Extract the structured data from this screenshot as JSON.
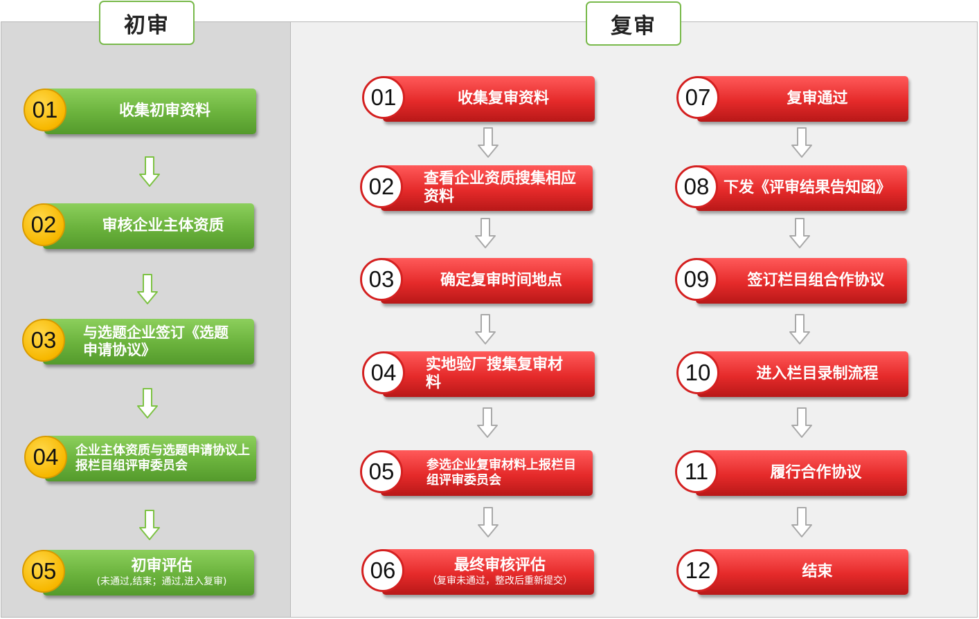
{
  "preliminary": {
    "title": "初审",
    "steps": [
      {
        "num": "01",
        "text": "收集初审资料",
        "sub": ""
      },
      {
        "num": "02",
        "text": "审核企业主体资质",
        "sub": ""
      },
      {
        "num": "03",
        "text": "与选题企业签订《选题申请协议》",
        "sub": ""
      },
      {
        "num": "04",
        "text": "企业主体资质与选题申请协议上报栏目组评审委员会",
        "sub": ""
      },
      {
        "num": "05",
        "text": "初审评估",
        "sub": "(未通过,结束；通过,进入复审)"
      }
    ]
  },
  "final": {
    "title": "复审",
    "steps": [
      {
        "num": "01",
        "text": "收集复审资料",
        "sub": ""
      },
      {
        "num": "02",
        "text": "查看企业资质搜集相应资料",
        "sub": ""
      },
      {
        "num": "03",
        "text": "确定复审时间地点",
        "sub": ""
      },
      {
        "num": "04",
        "text": "实地验厂搜集复审材料",
        "sub": ""
      },
      {
        "num": "05",
        "text": "参选企业复审材料上报栏目组评审委员会",
        "sub": ""
      },
      {
        "num": "06",
        "text": "最终审核评估",
        "sub": "（复审未通过，整改后重新提交）"
      },
      {
        "num": "07",
        "text": "复审通过",
        "sub": ""
      },
      {
        "num": "08",
        "text": "下发《评审结果告知函》",
        "sub": ""
      },
      {
        "num": "09",
        "text": "签订栏目组合作协议",
        "sub": ""
      },
      {
        "num": "10",
        "text": "进入栏目录制流程",
        "sub": ""
      },
      {
        "num": "11",
        "text": "履行合作协议",
        "sub": ""
      },
      {
        "num": "12",
        "text": "结束",
        "sub": ""
      }
    ]
  },
  "colors": {
    "green_bar": "#6ab23c",
    "yellow_circle": "#f7b800",
    "red_bar": "#e52a2a",
    "red_border": "#d42020",
    "green_arrow": "#7cc242",
    "grey_arrow": "#a8a8a8",
    "left_panel_bg": "#d8d8d8",
    "right_panel_bg": "#f0f0f0"
  }
}
